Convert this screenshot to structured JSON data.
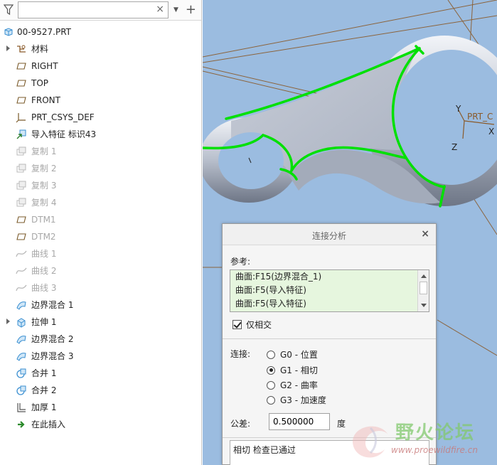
{
  "search": {
    "placeholder": "",
    "value": ""
  },
  "tree": {
    "root": "00-9527.PRT",
    "items": [
      {
        "label": "材料",
        "icon": "material-icon",
        "expandable": true,
        "suppressed": false
      },
      {
        "label": "RIGHT",
        "icon": "datum-plane-icon",
        "expandable": false,
        "suppressed": false
      },
      {
        "label": "TOP",
        "icon": "datum-plane-icon",
        "expandable": false,
        "suppressed": false
      },
      {
        "label": "FRONT",
        "icon": "datum-plane-icon",
        "expandable": false,
        "suppressed": false
      },
      {
        "label": "PRT_CSYS_DEF",
        "icon": "csys-icon",
        "expandable": false,
        "suppressed": false
      },
      {
        "label": "导入特征 标识43",
        "icon": "import-feature-icon",
        "expandable": false,
        "suppressed": false
      },
      {
        "label": "复制 1",
        "icon": "copy-icon",
        "expandable": false,
        "suppressed": true
      },
      {
        "label": "复制 2",
        "icon": "copy-icon",
        "expandable": false,
        "suppressed": true
      },
      {
        "label": "复制 3",
        "icon": "copy-icon",
        "expandable": false,
        "suppressed": true
      },
      {
        "label": "复制 4",
        "icon": "copy-icon",
        "expandable": false,
        "suppressed": true
      },
      {
        "label": "DTM1",
        "icon": "datum-plane-icon",
        "expandable": false,
        "suppressed": true
      },
      {
        "label": "DTM2",
        "icon": "datum-plane-icon",
        "expandable": false,
        "suppressed": true
      },
      {
        "label": "曲线 1",
        "icon": "curve-icon",
        "expandable": false,
        "suppressed": true
      },
      {
        "label": "曲线 2",
        "icon": "curve-icon",
        "expandable": false,
        "suppressed": true
      },
      {
        "label": "曲线 3",
        "icon": "curve-icon",
        "expandable": false,
        "suppressed": true
      },
      {
        "label": "边界混合 1",
        "icon": "boundary-blend-icon",
        "expandable": false,
        "suppressed": false
      },
      {
        "label": "拉伸 1",
        "icon": "extrude-icon",
        "expandable": true,
        "suppressed": false
      },
      {
        "label": "边界混合 2",
        "icon": "boundary-blend-icon",
        "expandable": false,
        "suppressed": false
      },
      {
        "label": "边界混合 3",
        "icon": "boundary-blend-icon",
        "expandable": false,
        "suppressed": false
      },
      {
        "label": "合并 1",
        "icon": "merge-icon",
        "expandable": false,
        "suppressed": false
      },
      {
        "label": "合并 2",
        "icon": "merge-icon",
        "expandable": false,
        "suppressed": false
      },
      {
        "label": "加厚 1",
        "icon": "thicken-icon",
        "expandable": false,
        "suppressed": false
      },
      {
        "label": "在此插入",
        "icon": "insert-here-icon",
        "expandable": false,
        "suppressed": false
      }
    ]
  },
  "viewport": {
    "axis_y": "Y",
    "axis_x": "X",
    "axis_z": "Z",
    "csys_name": "PRT_C"
  },
  "dialog": {
    "title": "连接分析",
    "close": "×",
    "reference_label": "参考:",
    "references": [
      "曲面:F15(边界混合_1)",
      "曲面:F5(导入特征)",
      "曲面:F5(导入特征)"
    ],
    "only_intersect": {
      "label": "仅相交",
      "checked": true
    },
    "connection_label": "连接:",
    "options": [
      {
        "label": "G0 - 位置",
        "selected": false
      },
      {
        "label": "G1 - 相切",
        "selected": true
      },
      {
        "label": "G2 - 曲率",
        "selected": false
      },
      {
        "label": "G3 - 加速度",
        "selected": false
      }
    ],
    "tolerance_label": "公差:",
    "tolerance_value": "0.500000",
    "tolerance_unit": "度",
    "result": "相切 检查已通过"
  },
  "watermark": {
    "title": "野火论坛",
    "url": "www.proewildfire.cn"
  },
  "colors": {
    "viewport_bg": "#9bbce0",
    "edge_highlight": "#00e000",
    "datum": "#8a5a2a",
    "surface": "#c9ced8"
  }
}
